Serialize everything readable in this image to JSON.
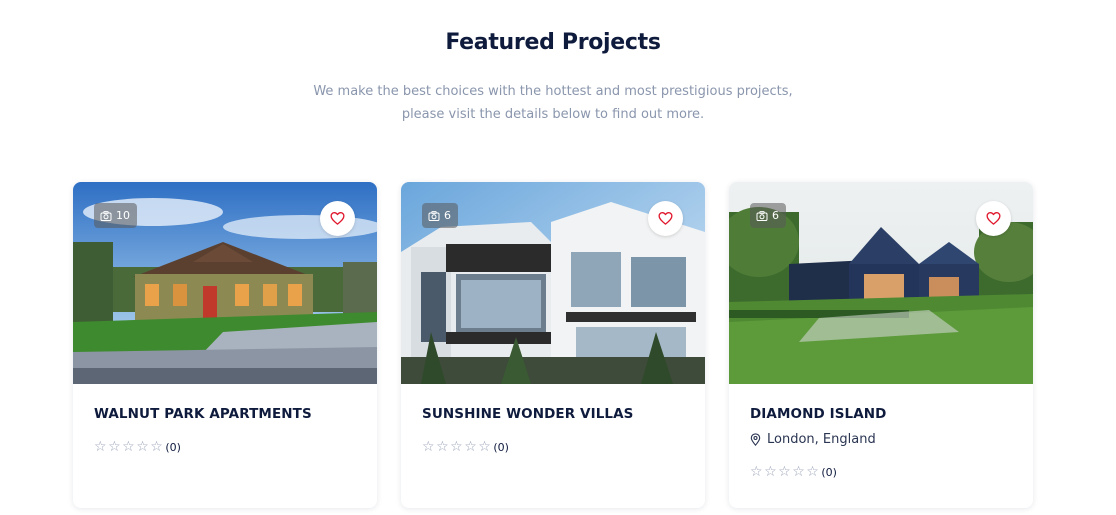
{
  "section": {
    "title": "Featured Projects",
    "subtitle": "We make the best choices with the hottest and most prestigious projects, please visit the details below to find out more."
  },
  "cards": [
    {
      "name": "WALNUT PARK APARTMENTS",
      "photo_count": "10",
      "location": "",
      "rating_count": "(0)",
      "stars": 5,
      "favorited": false
    },
    {
      "name": "SUNSHINE WONDER VILLAS",
      "photo_count": "6",
      "location": "",
      "rating_count": "(0)",
      "stars": 5,
      "favorited": false
    },
    {
      "name": "DIAMOND ISLAND",
      "photo_count": "6",
      "location": "London, England",
      "rating_count": "(0)",
      "stars": 5,
      "favorited": false
    }
  ],
  "icons": {
    "photo_badge": "camera-icon",
    "favorite": "heart-icon",
    "location": "map-pin-icon",
    "rating": "star-outline-icon"
  },
  "colors": {
    "heading": "#0f1b3d",
    "subtitle": "#8a96ad",
    "heart": "#e0182d",
    "star_outline": "#9aa3b8"
  }
}
